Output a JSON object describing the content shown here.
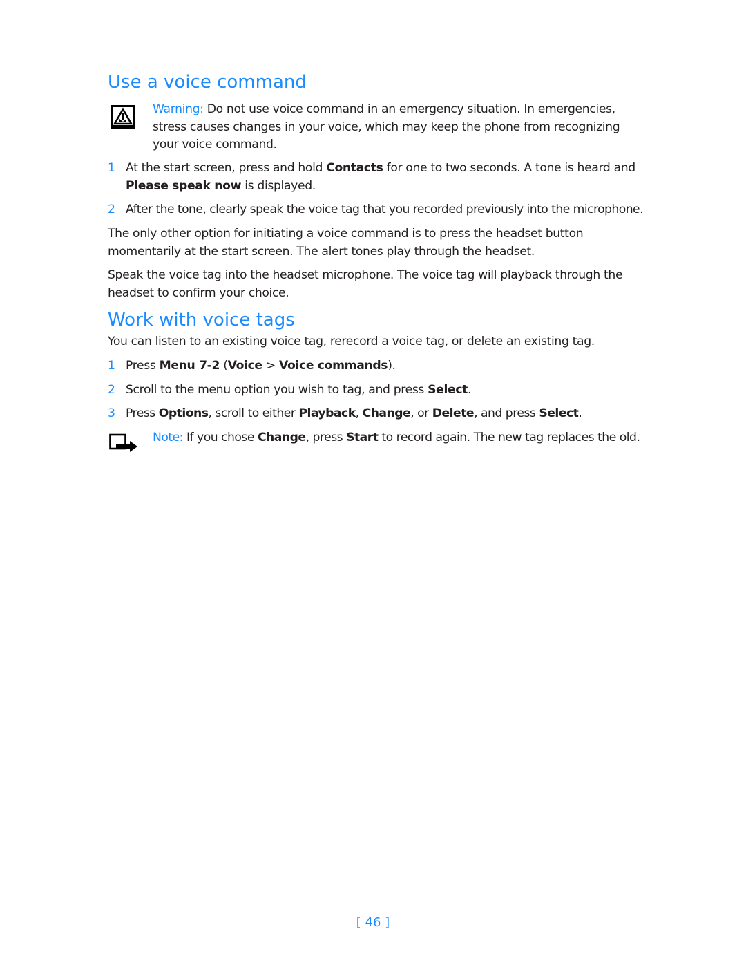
{
  "section1": {
    "title": "Use a voice command",
    "warning": {
      "icon": "warning-triangle-icon",
      "label": "Warning:",
      "text": " Do not use voice command in an emergency situation. In emergencies, stress causes changes in your voice, which may keep the phone from recognizing your voice command."
    },
    "steps": [
      {
        "num": "1",
        "parts": [
          "At the start screen, press and hold ",
          "Contacts",
          " for one to two seconds. A tone is heard and ",
          "Please speak now",
          " is displayed."
        ]
      },
      {
        "num": "2",
        "text": "After the tone, clearly speak the voice tag that you recorded previously into the microphone."
      }
    ],
    "paragraphs": [
      "The only other option for initiating a voice command is to press the headset button momentarily at the start screen. The alert tones play through the headset.",
      "Speak the voice tag into the headset microphone. The voice tag will playback through the headset to confirm your choice."
    ]
  },
  "section2": {
    "title": "Work with voice tags",
    "intro": "You can listen to an existing voice tag, rerecord a voice tag, or delete an existing tag.",
    "steps": [
      {
        "num": "1",
        "parts": [
          "Press ",
          "Menu 7-2",
          " (",
          "Voice",
          " > ",
          "Voice commands",
          ")."
        ]
      },
      {
        "num": "2",
        "parts": [
          "Scroll to the menu option you wish to tag, and press ",
          "Select",
          "."
        ]
      },
      {
        "num": "3",
        "parts": [
          "Press ",
          "Options",
          ", scroll to either ",
          "Playback",
          ", ",
          "Change",
          ", or ",
          "Delete",
          ", and press ",
          "Select",
          "."
        ]
      }
    ],
    "note": {
      "icon": "note-pointer-icon",
      "label": "Note:",
      "parts": [
        " If you chose ",
        "Change",
        ", press ",
        "Start",
        " to record again. The new tag replaces the old."
      ]
    }
  },
  "footer": {
    "page_number": "[ 46 ]"
  },
  "colors": {
    "accent": "#1a8cff",
    "text": "#231f20"
  }
}
